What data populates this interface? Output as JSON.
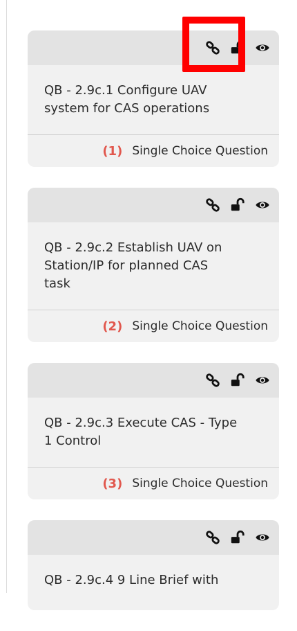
{
  "questions": [
    {
      "title": "QB - 2.9c.1 Configure UAV system for CAS operations",
      "index": "(1)",
      "type": "Single Choice Question"
    },
    {
      "title": "QB - 2.9c.2 Establish UAV on Station/IP for planned CAS task",
      "index": "(2)",
      "type": "Single Choice Question"
    },
    {
      "title": "QB - 2.9c.3 Execute CAS - Type 1 Control",
      "index": "(3)",
      "type": "Single Choice Question"
    },
    {
      "title": "QB - 2.9c.4 9 Line Brief with",
      "index": "",
      "type": ""
    }
  ],
  "icons": {
    "link": "link-icon",
    "unlock": "unlock-icon",
    "view": "eye-icon"
  },
  "colors": {
    "index_accent": "#e1574d",
    "highlight": "#ff0000",
    "card_bg": "#f1f1f1",
    "header_bg": "#e3e3e3"
  }
}
